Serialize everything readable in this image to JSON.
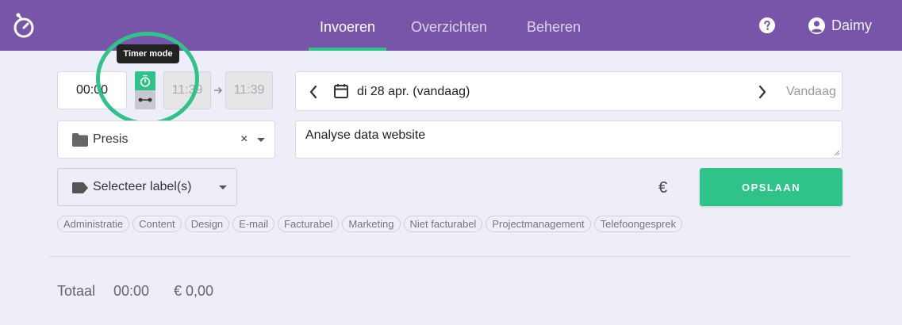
{
  "header": {
    "nav": [
      {
        "label": "Invoeren",
        "active": true
      },
      {
        "label": "Overzichten",
        "active": false
      },
      {
        "label": "Beheren",
        "active": false
      }
    ],
    "user": "Daimy",
    "icons": {
      "logo": "stopwatch-logo-icon",
      "help": "question-circle-icon",
      "user": "user-circle-icon"
    }
  },
  "entry": {
    "duration": "00:00",
    "tooltip": "Timer mode",
    "start_time": "11:39",
    "end_time": "11:39",
    "date": "di 28 apr. (vandaag)",
    "today_label": "Vandaag",
    "project": "Presis",
    "clear_symbol": "×",
    "description": "Analyse data website",
    "label_placeholder": "Selecteer label(s)",
    "currency_symbol": "€",
    "save_label": "OPSLAAN"
  },
  "labels": [
    "Administratie",
    "Content",
    "Design",
    "E-mail",
    "Facturabel",
    "Marketing",
    "Niet facturabel",
    "Projectmanagement",
    "Telefoongesprek"
  ],
  "totals": {
    "label": "Totaal",
    "time": "00:00",
    "amount": "€ 0,00"
  },
  "colors": {
    "brand": "#7855a9",
    "accent": "#2fc38a",
    "background": "#eeeef8"
  }
}
